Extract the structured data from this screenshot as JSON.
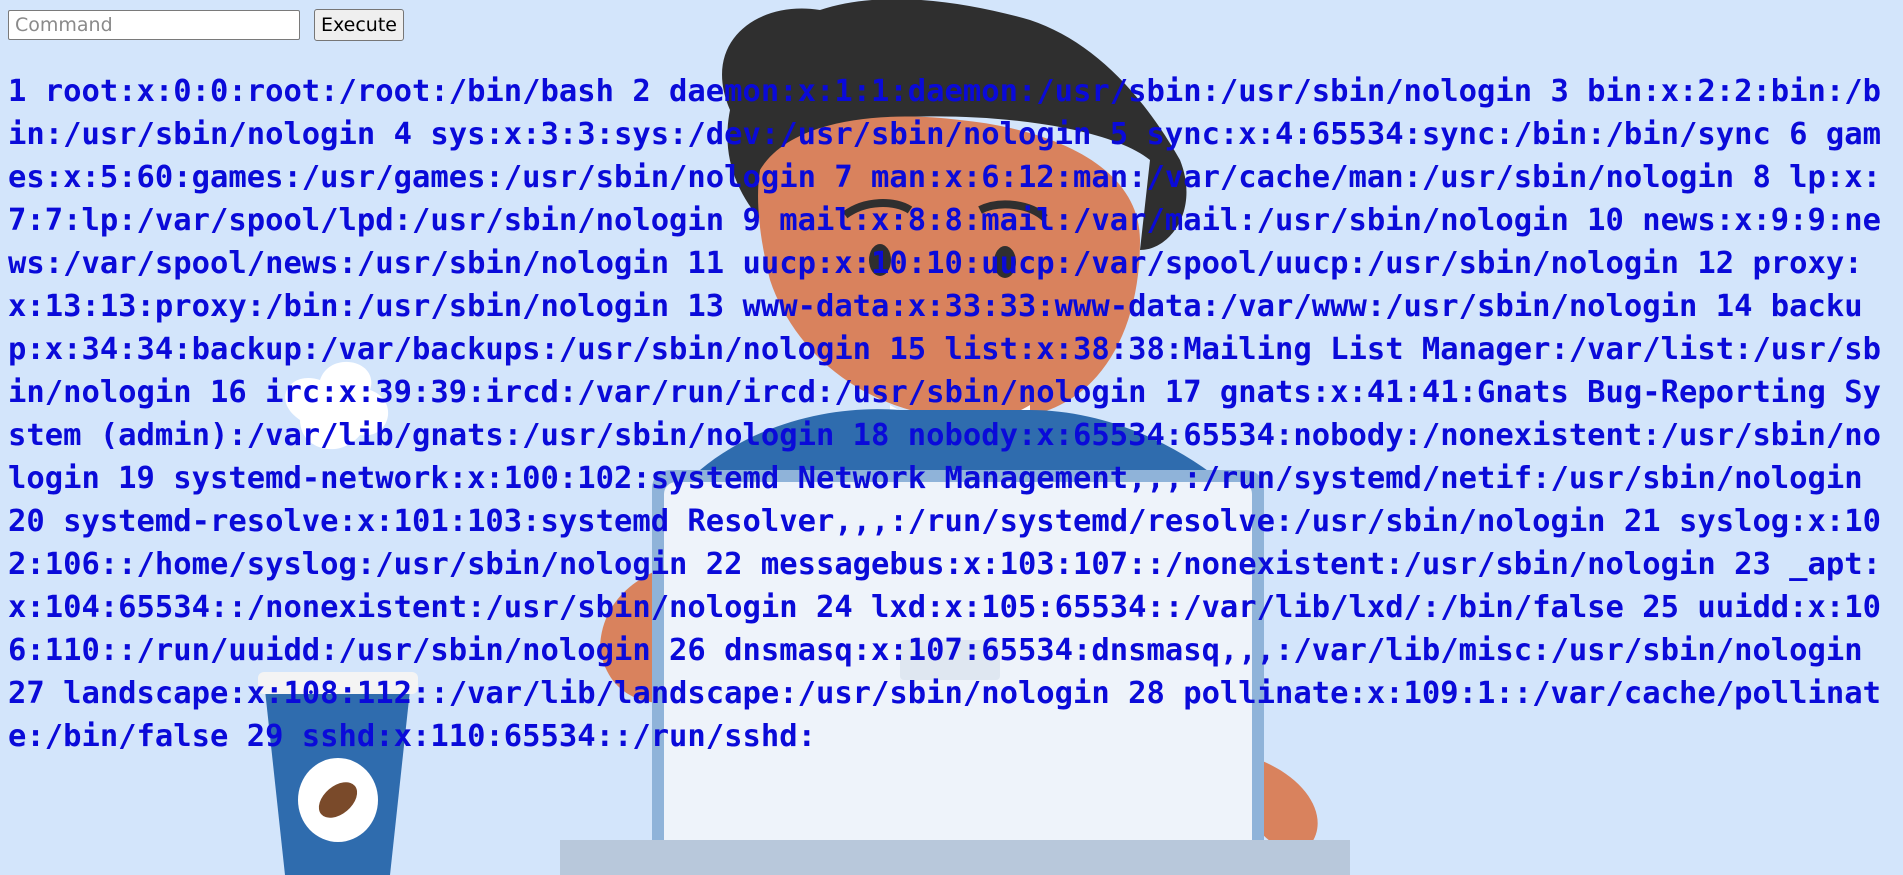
{
  "command": {
    "placeholder": "Command",
    "value": "",
    "execute_label": "Execute"
  },
  "output": {
    "text": "1 root:x:0:0:root:/root:/bin/bash 2 daemon:x:1:1:daemon:/usr/sbin:/usr/sbin/nologin 3 bin:x:2:2:bin:/bin:/usr/sbin/nologin 4 sys:x:3:3:sys:/dev:/usr/sbin/nologin 5 sync:x:4:65534:sync:/bin:/bin/sync 6 games:x:5:60:games:/usr/games:/usr/sbin/nologin 7 man:x:6:12:man:/var/cache/man:/usr/sbin/nologin 8 lp:x:7:7:lp:/var/spool/lpd:/usr/sbin/nologin 9 mail:x:8:8:mail:/var/mail:/usr/sbin/nologin 10 news:x:9:9:news:/var/spool/news:/usr/sbin/nologin 11 uucp:x:10:10:uucp:/var/spool/uucp:/usr/sbin/nologin 12 proxy:x:13:13:proxy:/bin:/usr/sbin/nologin 13 www-data:x:33:33:www-data:/var/www:/usr/sbin/nologin 14 backup:x:34:34:backup:/var/backups:/usr/sbin/nologin 15 list:x:38:38:Mailing List Manager:/var/list:/usr/sbin/nologin 16 irc:x:39:39:ircd:/var/run/ircd:/usr/sbin/nologin 17 gnats:x:41:41:Gnats Bug-Reporting System (admin):/var/lib/gnats:/usr/sbin/nologin 18 nobody:x:65534:65534:nobody:/nonexistent:/usr/sbin/nologin 19 systemd-network:x:100:102:systemd Network Management,,,:/run/systemd/netif:/usr/sbin/nologin 20 systemd-resolve:x:101:103:systemd Resolver,,,:/run/systemd/resolve:/usr/sbin/nologin 21 syslog:x:102:106::/home/syslog:/usr/sbin/nologin 22 messagebus:x:103:107::/nonexistent:/usr/sbin/nologin 23 _apt:x:104:65534::/nonexistent:/usr/sbin/nologin 24 lxd:x:105:65534::/var/lib/lxd/:/bin/false 25 uuidd:x:106:110::/run/uuidd:/usr/sbin/nologin 26 dnsmasq:x:107:65534:dnsmasq,,,:/var/lib/misc:/usr/sbin/nologin 27 landscape:x:108:112::/var/lib/landscape:/usr/sbin/nologin 28 pollinate:x:109:1::/var/cache/pollinate:/bin/false 29 sshd:x:110:65534::/run/sshd:"
  },
  "colors": {
    "background": "#d3e5fb",
    "output_text": "#0a0ad9"
  },
  "background_art": {
    "icon": "person-at-laptop-with-coffee-illustration"
  }
}
